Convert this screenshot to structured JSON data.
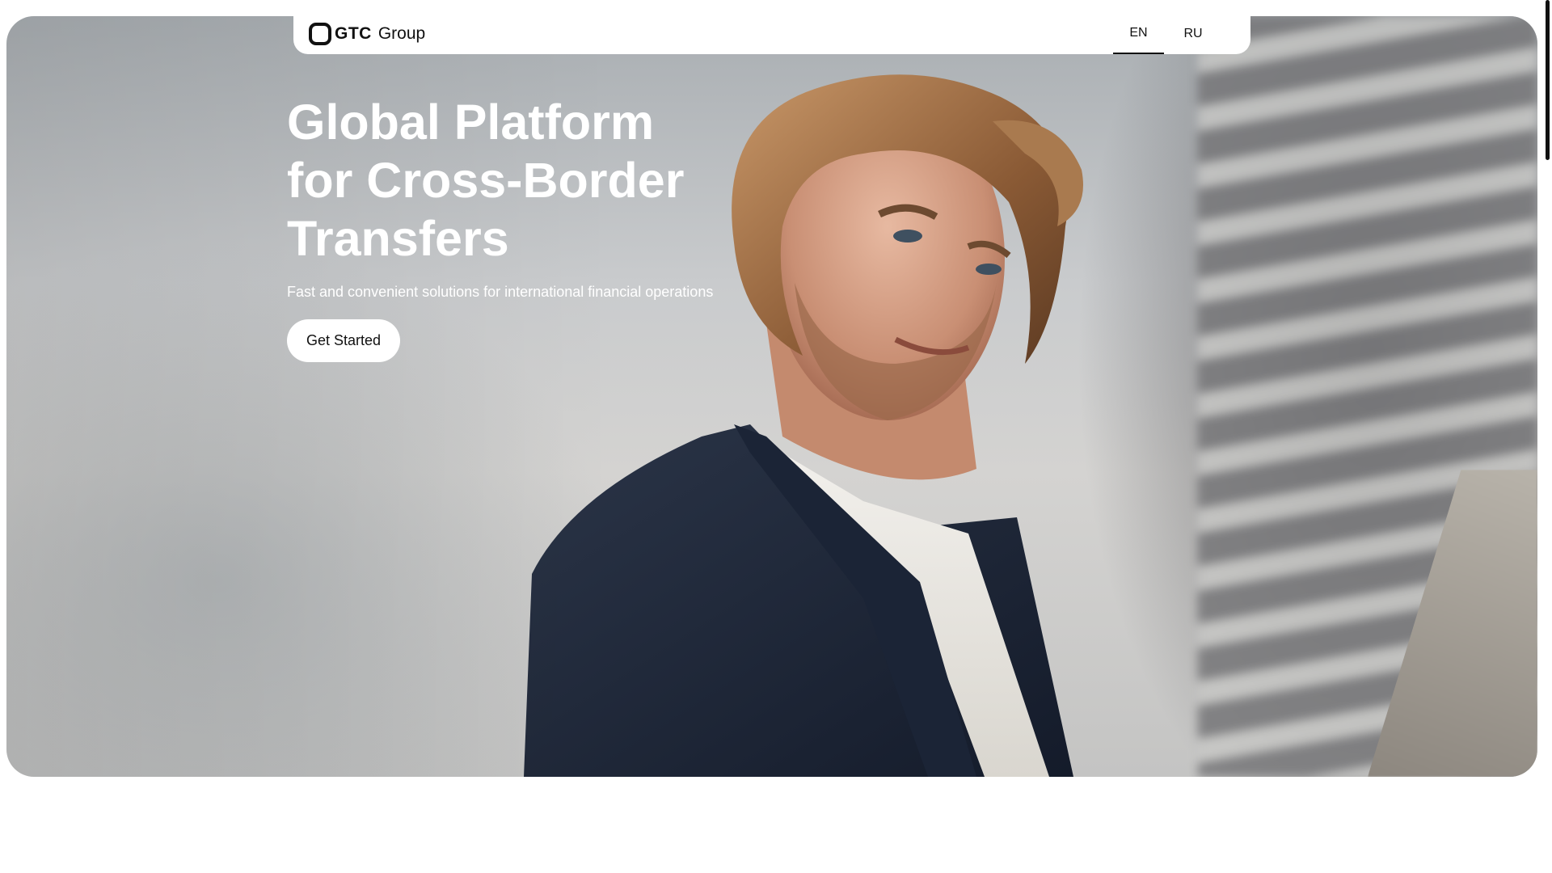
{
  "nav": {
    "logo_gtc": "GTC",
    "logo_group": "Group",
    "languages": [
      {
        "code": "EN",
        "active": true
      },
      {
        "code": "RU",
        "active": false
      }
    ]
  },
  "hero": {
    "title_line1": "Global Platform",
    "title_line2": "for Cross-Border",
    "title_line3": "Transfers",
    "subtitle": "Fast and convenient solutions for international financial operations",
    "cta_label": "Get Started"
  },
  "icons": {
    "logo": "gtc-logo-icon"
  },
  "colors": {
    "nav_bg": "#ffffff",
    "hero_text": "#ffffff",
    "cta_bg": "#ffffff",
    "cta_text": "#111111"
  }
}
